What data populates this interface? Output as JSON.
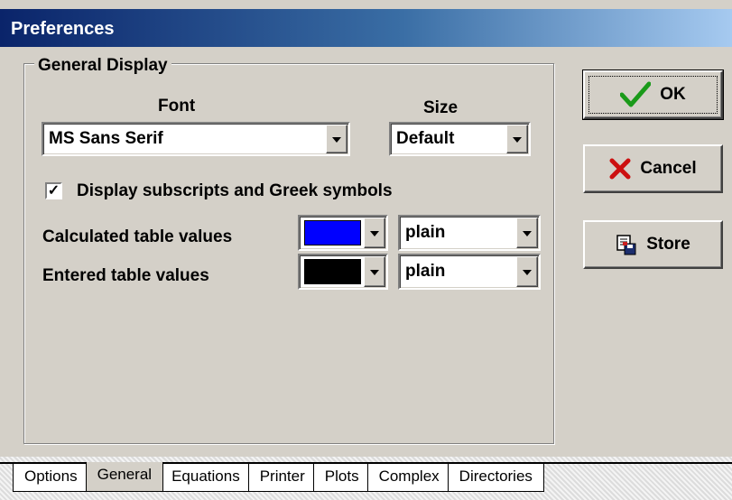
{
  "window": {
    "title": "Preferences"
  },
  "general_display": {
    "legend": "General Display",
    "font_label": "Font",
    "size_label": "Size",
    "font_value": "MS Sans Serif",
    "size_value": "Default",
    "checkbox_label": "Display subscripts and Greek symbols",
    "checkbox_checked": true,
    "check_mark": "✓",
    "calculated": {
      "label": "Calculated table values",
      "color": "#0000ff",
      "style": "plain"
    },
    "entered": {
      "label": "Entered table values",
      "color": "#000000",
      "style": "plain"
    }
  },
  "buttons": {
    "ok": "OK",
    "cancel": "Cancel",
    "store": "Store"
  },
  "icons": {
    "ok": "green-check-icon",
    "cancel": "red-x-icon",
    "store": "store-disk-icon"
  },
  "tabs": [
    {
      "label": "Options",
      "active": false
    },
    {
      "label": "General",
      "active": true
    },
    {
      "label": "Equations",
      "active": false
    },
    {
      "label": "Printer",
      "active": false
    },
    {
      "label": "Plots",
      "active": false
    },
    {
      "label": "Complex",
      "active": false
    },
    {
      "label": "Directories",
      "active": false
    }
  ]
}
